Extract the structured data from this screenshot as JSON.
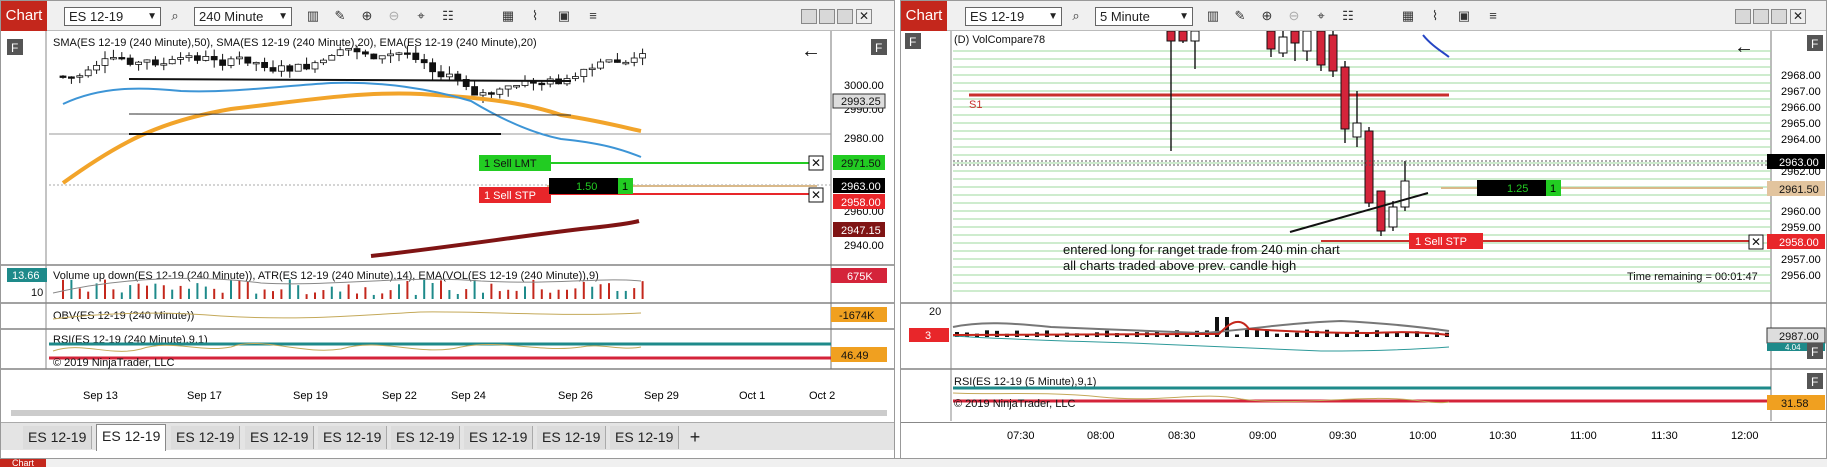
{
  "left": {
    "title": "Chart",
    "instrument": "ES 12-19",
    "period": "240 Minute",
    "indicator_labels": {
      "price": "SMA(ES 12-19 (240 Minute),50), SMA(ES 12-19 (240 Minute),20), EMA(ES 12-19 (240 Minute),20)",
      "volume": "Volume up down(ES 12-19 (240 Minute)), ATR(ES 12-19 (240 Minute),14), EMA(VOL(ES 12-19 (240 Minute)),9)",
      "obv": "OBV(ES 12-19 (240 Minute))",
      "rsi": "RSI(ES 12-19 (240 Minute),9,1)"
    },
    "copyright": "© 2019 NinjaTrader, LLC",
    "panel_button": "F",
    "price_ticks": [
      "3000.00",
      "2990.00",
      "2980.00",
      "2970.00",
      "2960.00",
      "2950.00",
      "2940.00"
    ],
    "price_badges": {
      "current": "2993.25",
      "sell_lmt_price": "2971.50",
      "last": "2963.00",
      "sell_stp_price": "2958.00",
      "ma": "2947.15",
      "vol": "675K",
      "obv": "-1674K",
      "rsi": "46.49"
    },
    "orders": {
      "sell_lmt": "1  Sell LMT",
      "sell_stp": "1  Sell STP",
      "position_pnl": "1.50",
      "position_qty": "1",
      "close_icon": "✕"
    },
    "volume_value": "13.66",
    "volume_tick": "10",
    "x_ticks": [
      "Sep 13",
      "Sep 17",
      "Sep 19",
      "Sep 22",
      "Sep 24",
      "Sep 26",
      "Sep 29",
      "Oct 1",
      "Oct 2"
    ],
    "tabs": [
      "ES 12-19",
      "ES 12-19",
      "ES 12-19",
      "ES 12-19",
      "ES 12-19",
      "ES 12-19",
      "ES 12-19",
      "ES 12-19",
      "ES 12-19"
    ],
    "active_tab": 1,
    "tab_add": "+"
  },
  "right": {
    "title": "Chart",
    "instrument": "ES 12-19",
    "period": "5 Minute",
    "indicator_label": "(D) VolCompare78",
    "rsi_label": "RSI(ES 12-19 (5 Minute),9,1)",
    "copyright": "© 2019 NinjaTrader, LLC",
    "panel_button": "F",
    "s1_label": "S1",
    "price_ticks": [
      "2968.00",
      "2967.00",
      "2966.00",
      "2965.00",
      "2964.00",
      "2963.00",
      "2962.00",
      "2961.00",
      "2960.00",
      "2959.00",
      "2958.00",
      "2957.00",
      "2956.00"
    ],
    "price_badges": {
      "last": "2963.00",
      "position": "2961.50",
      "sell_stp_price": "2958.00",
      "vol": "2987.00",
      "vol_sub": "4.04",
      "rsi": "31.58"
    },
    "orders": {
      "sell_stp": "1  Sell STP",
      "position_pnl": "1.25",
      "position_qty": "1"
    },
    "annotation_line1": "entered long for ranget trade from 240 min chart",
    "annotation_line2": "all charts traded above prev. candle high",
    "time_remaining": "Time remaining = 00:01:47",
    "vol_tick": "20",
    "vol_value": "3",
    "x_ticks": [
      "07:30",
      "08:00",
      "08:30",
      "09:00",
      "09:30",
      "10:00",
      "10:30",
      "11:00",
      "11:30",
      "12:00"
    ]
  },
  "colors": {
    "brand_red": "#c4271c",
    "buy_green": "#22cc22",
    "sell_red": "#e8262a",
    "sma50": "#f2a42a",
    "ema20": "#3d95d6",
    "ma_dark": "#7f1414",
    "grid_green": "#9ed89e"
  },
  "icons": [
    "search-icon",
    "bar-type-icon",
    "pencil-icon",
    "zoom-in-icon",
    "zoom-out-icon",
    "crosshair-icon",
    "properties-icon",
    "data-box-icon",
    "strategies-icon",
    "snapshot-icon",
    "menu-icon"
  ]
}
